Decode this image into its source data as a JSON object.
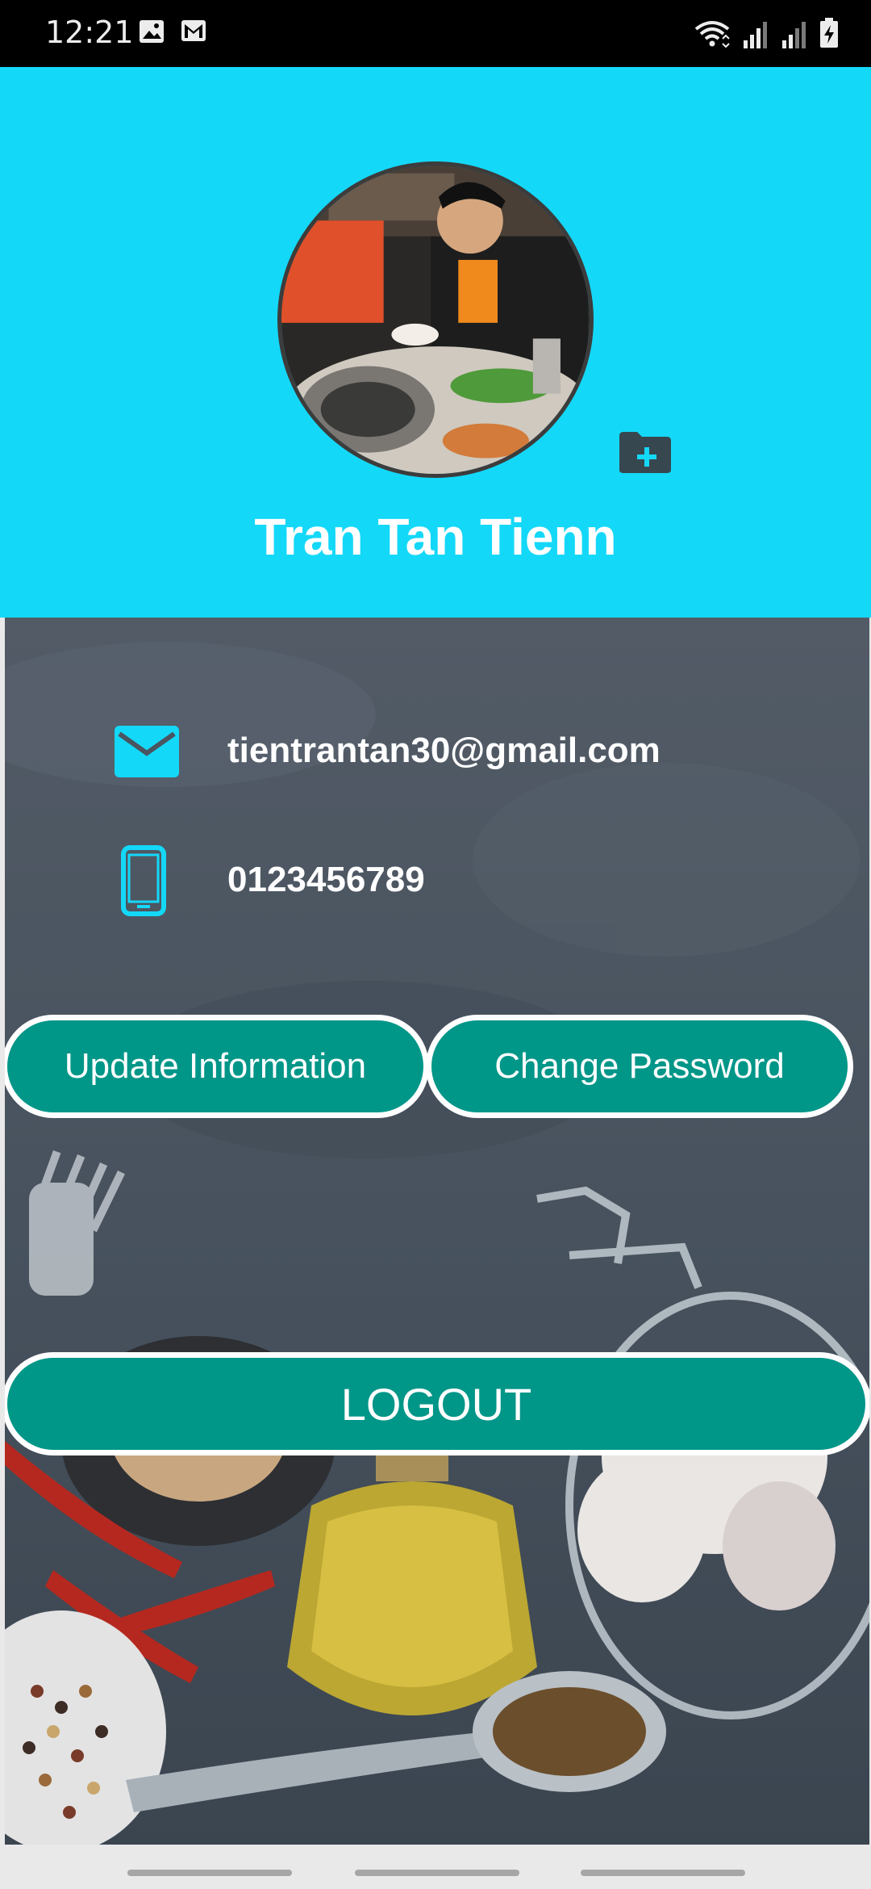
{
  "status_bar": {
    "time": "12:21",
    "icons_left": [
      "image-icon",
      "gmail-icon"
    ],
    "icons_right": [
      "wifi-icon",
      "signal-icon",
      "signal-icon-2",
      "battery-charging-icon"
    ]
  },
  "header": {
    "avatar_alt": "profile-photo",
    "add_photo_icon": "folder-add-icon",
    "name": "Tran Tan Tienn",
    "background_color": "#14d8f8"
  },
  "profile": {
    "email": "tientrantan30@gmail.com",
    "email_icon": "mail-icon",
    "phone": "0123456789",
    "phone_icon": "phone-icon",
    "icon_color": "#14d8f8"
  },
  "actions": {
    "update_label": "Update Information",
    "change_password_label": "Change Password",
    "logout_label": "LOGOUT",
    "button_color": "#009688"
  }
}
